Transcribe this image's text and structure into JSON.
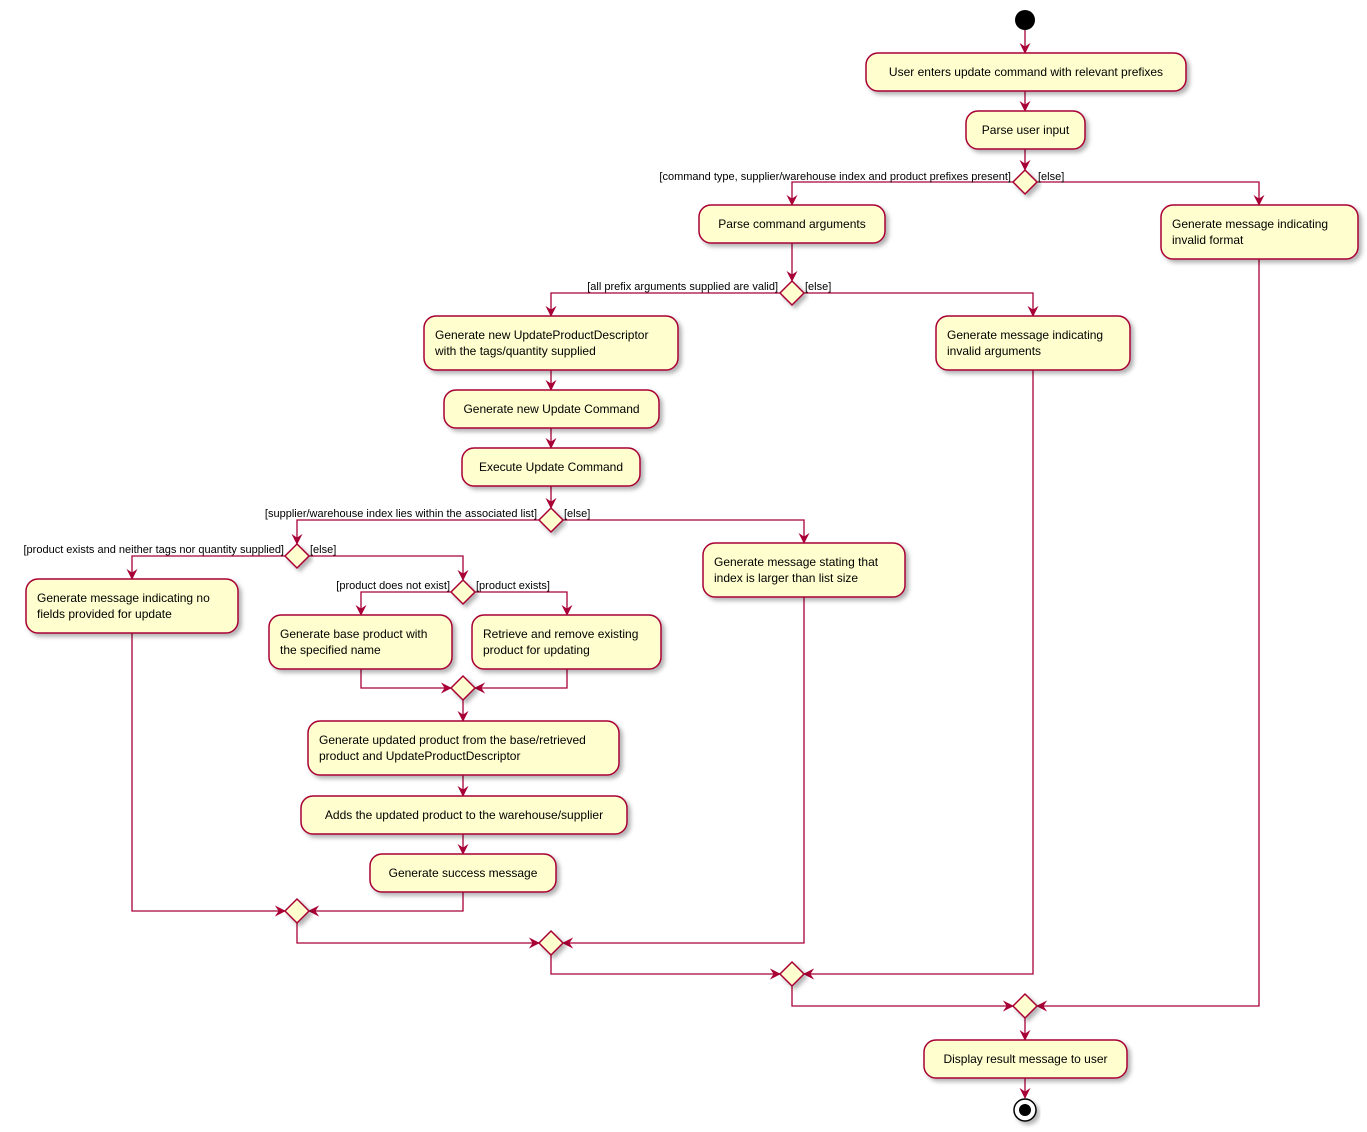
{
  "diagram": {
    "type": "uml-activity",
    "colors": {
      "node_fill": "#FEFECE",
      "border": "#A80036",
      "start": "#000000"
    },
    "activities": {
      "user_enters": [
        "User enters update command with relevant prefixes"
      ],
      "parse_input": [
        "Parse user input"
      ],
      "parse_args": [
        "Parse command arguments"
      ],
      "invalid_format": [
        "Generate message indicating",
        "invalid format"
      ],
      "gen_descriptor": [
        "Generate new UpdateProductDescriptor",
        "with the tags/quantity supplied"
      ],
      "invalid_args": [
        "Generate message indicating",
        "invalid arguments"
      ],
      "gen_command": [
        "Generate new Update Command"
      ],
      "exec_command": [
        "Execute Update Command"
      ],
      "index_too_large": [
        "Generate message stating that",
        "index is larger than list size"
      ],
      "no_fields": [
        "Generate message indicating no",
        "fields provided for update"
      ],
      "base_product": [
        "Generate base product with",
        "the specified name"
      ],
      "retrieve_product": [
        "Retrieve and remove existing",
        "product for updating"
      ],
      "updated_product": [
        "Generate updated product from the base/retrieved",
        "product and UpdateProductDescriptor"
      ],
      "add_product": [
        "Adds the updated product to the warehouse/supplier"
      ],
      "success": [
        "Generate success message"
      ],
      "display": [
        "Display result message to user"
      ]
    },
    "guards": {
      "prefixes_present": "[command type, supplier/warehouse index and product prefixes present]",
      "else1": "[else]",
      "args_valid": "[all prefix arguments supplied are valid]",
      "else2": "[else]",
      "index_within": "[supplier/warehouse index lies within the associated list]",
      "else3": "[else]",
      "no_tags_qty": "[product exists and neither tags nor quantity supplied]",
      "else4": "[else]",
      "not_exist": "[product does not exist]",
      "exists": "[product exists]"
    }
  }
}
